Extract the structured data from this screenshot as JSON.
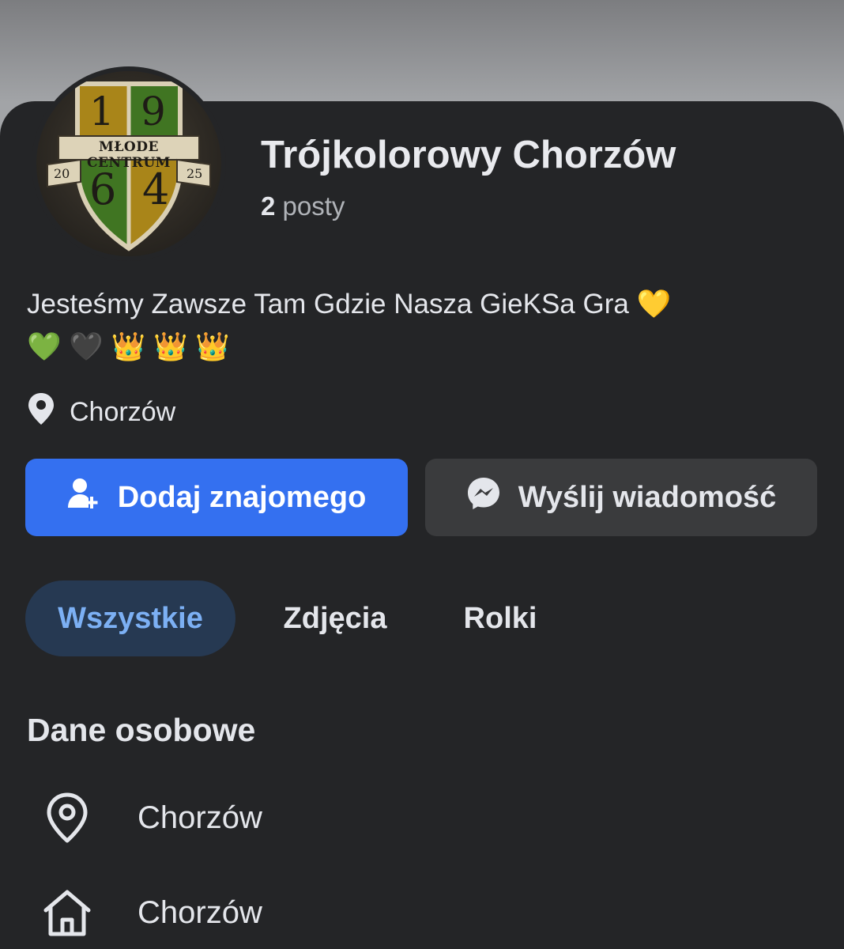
{
  "profile": {
    "name": "Trójkolorowy Chorzów",
    "posts_count": "2",
    "posts_label": "posty",
    "avatar": {
      "top_left_digit": "1",
      "top_right_digit": "9",
      "banner": "MŁODE CENTRUM",
      "year_left": "20",
      "year_right": "25",
      "bottom_left_digit": "6",
      "bottom_right_digit": "4"
    }
  },
  "bio": {
    "text": "Jesteśmy Zawsze Tam Gdzie Nasza GieKSa Gra",
    "emoji_line1": "💛",
    "emoji_line2": [
      "💚",
      "🖤",
      "👑",
      "👑",
      "👑"
    ]
  },
  "location": {
    "icon": "map-pin-filled-icon",
    "label": "Chorzów"
  },
  "actions": {
    "add_friend_label": "Dodaj znajomego",
    "add_friend_icon": "add-person-icon",
    "message_label": "Wyślij wiadomość",
    "message_icon": "messenger-icon"
  },
  "tabs": [
    {
      "label": "Wszystkie",
      "active": true
    },
    {
      "label": "Zdjęcia",
      "active": false
    },
    {
      "label": "Rolki",
      "active": false
    }
  ],
  "details": {
    "title": "Dane osobowe",
    "items": [
      {
        "icon": "map-pin-outline-icon",
        "label": "Chorzów"
      },
      {
        "icon": "home-icon",
        "label": "Chorzów"
      }
    ]
  },
  "colors": {
    "background": "#242527",
    "primary_button": "#3470f0",
    "secondary_button": "#3a3b3d",
    "active_tab_bg": "#263952",
    "active_tab_text": "#7cb0f4"
  }
}
